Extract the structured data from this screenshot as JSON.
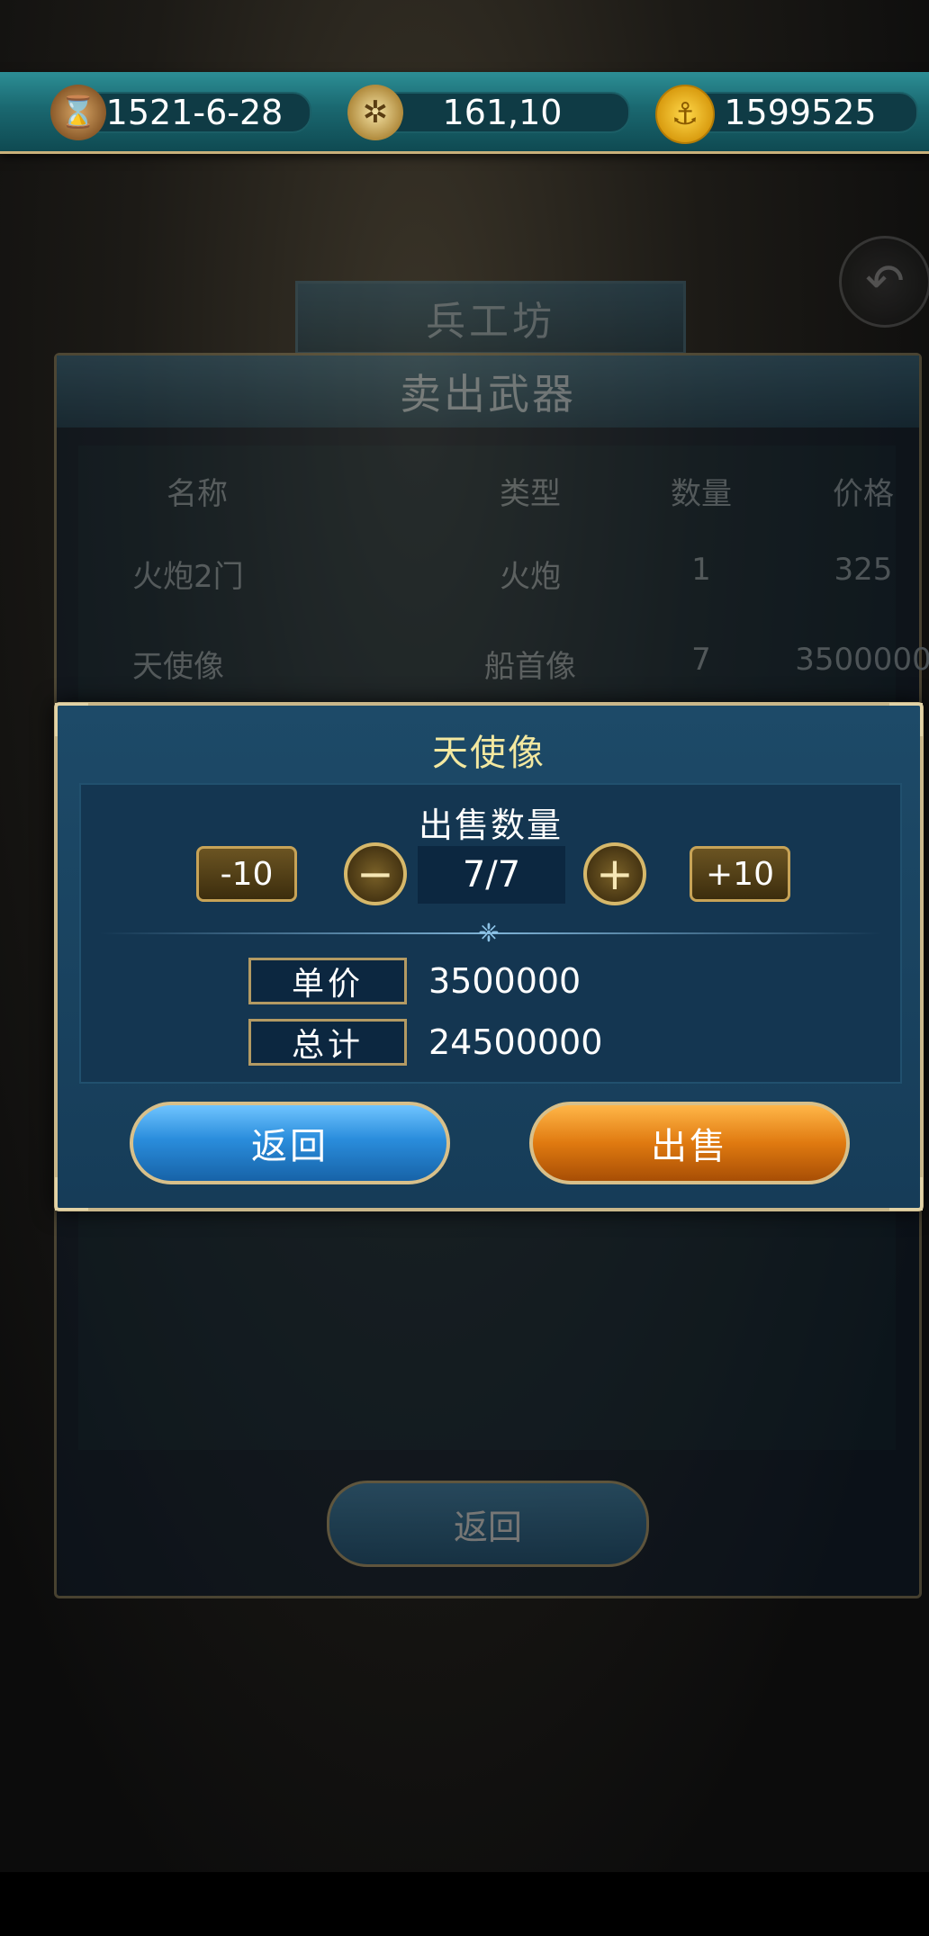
{
  "topbar": {
    "date": "1521-6-28",
    "coords": "161,10",
    "gold": "1599525",
    "icons": [
      "hourglass-icon",
      "compass-icon",
      "anchor-coin-icon"
    ]
  },
  "background": {
    "tag": "兵工坊",
    "panel_title": "卖出武器",
    "columns": [
      "名称",
      "类型",
      "数量",
      "价格"
    ],
    "rows": [
      {
        "name": "火炮2门",
        "type": "火炮",
        "qty": "1",
        "price": "325"
      },
      {
        "name": "天使像",
        "type": "船首像",
        "qty": "7",
        "price": "3500000"
      }
    ],
    "return_label": "返回"
  },
  "modal": {
    "item_name": "天使像",
    "quantity_label": "出售数量",
    "minus10": "-10",
    "plus10": "+10",
    "minus_symbol": "−",
    "plus_symbol": "+",
    "quantity": "7/7",
    "unit_price_label": "单价",
    "unit_price": "3500000",
    "total_label": "总计",
    "total": "24500000",
    "return_label": "返回",
    "sell_label": "出售"
  },
  "colors": {
    "title_yellow": "#f3e8a0",
    "return_blue": "#2a8ddc",
    "sell_orange": "#e07a10",
    "gold_border": "#c9b78a"
  }
}
